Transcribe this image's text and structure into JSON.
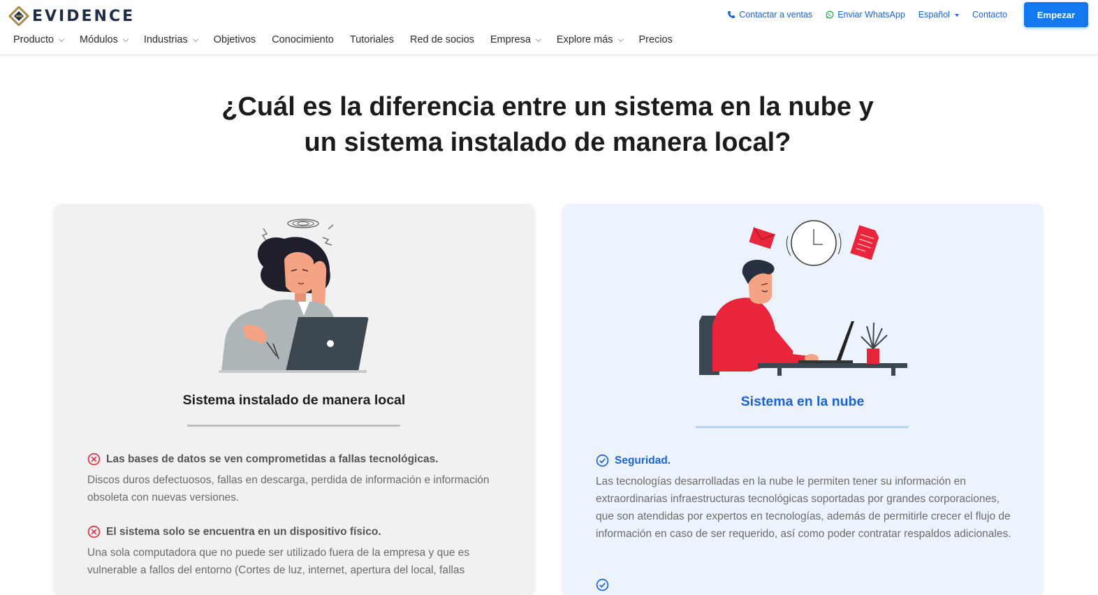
{
  "brand": {
    "name": "EVIDENCE",
    "logo_icon": "evidence-logo-icon",
    "colors": {
      "logo_gold": "#a88a4c",
      "logo_navy": "#1f2d44"
    }
  },
  "top_bar": {
    "contact_sales": "Contactar a ventas",
    "whatsapp": "Enviar WhatsApp",
    "language": "Español",
    "contact": "Contacto",
    "start_button": "Empezar"
  },
  "nav": {
    "items": [
      {
        "label": "Producto",
        "has_dropdown": true
      },
      {
        "label": "Módulos",
        "has_dropdown": true
      },
      {
        "label": "Industrias",
        "has_dropdown": true
      },
      {
        "label": "Objetivos",
        "has_dropdown": false
      },
      {
        "label": "Conocimiento",
        "has_dropdown": false
      },
      {
        "label": "Tutoriales",
        "has_dropdown": false
      },
      {
        "label": "Red de socios",
        "has_dropdown": false
      },
      {
        "label": "Empresa",
        "has_dropdown": true
      },
      {
        "label": "Explore más",
        "has_dropdown": true
      },
      {
        "label": "Precios",
        "has_dropdown": false
      }
    ]
  },
  "heading": {
    "line1": "¿Cuál es la diferencia entre un sistema en la nube y",
    "line2": "un sistema instalado de manera local?"
  },
  "cards": {
    "local": {
      "title": "Sistema instalado de manera local",
      "illustration": "stressed-woman-laptop-illustration",
      "features": [
        {
          "icon": "x-circle-icon",
          "title": "Las bases de datos se ven comprometidas a fallas tecnológicas.",
          "body": "Discos duros defectuosos, fallas en descarga, perdida de información e información obsoleta con nuevas versiones."
        },
        {
          "icon": "x-circle-icon",
          "title": "El sistema solo se encuentra en un dispositivo físico.",
          "body": "Una sola computadora que no puede ser utilizado fuera de la empresa y que es vulnerable a fallos del entorno (Cortes de luz, internet, apertura del local, fallas"
        }
      ]
    },
    "cloud": {
      "title": "Sistema en la nube",
      "illustration": "man-working-laptop-illustration",
      "features": [
        {
          "icon": "check-circle-icon",
          "title": "Seguridad.",
          "body": "Las tecnologías desarrolladas en la nube le permiten tener su información en extraordinarias infraestructuras tecnológicas soportadas por grandes corporaciones, que son atendidas por expertos en tecnologías, además de permitirle crecer el flujo de información en caso de ser requerido, así como poder contratar respaldos adicionales."
        }
      ]
    }
  },
  "colors": {
    "accent_blue": "#1a63d6",
    "button_blue": "#1479f0",
    "error_red": "#e0303f",
    "illus_red": "#e8253a"
  }
}
